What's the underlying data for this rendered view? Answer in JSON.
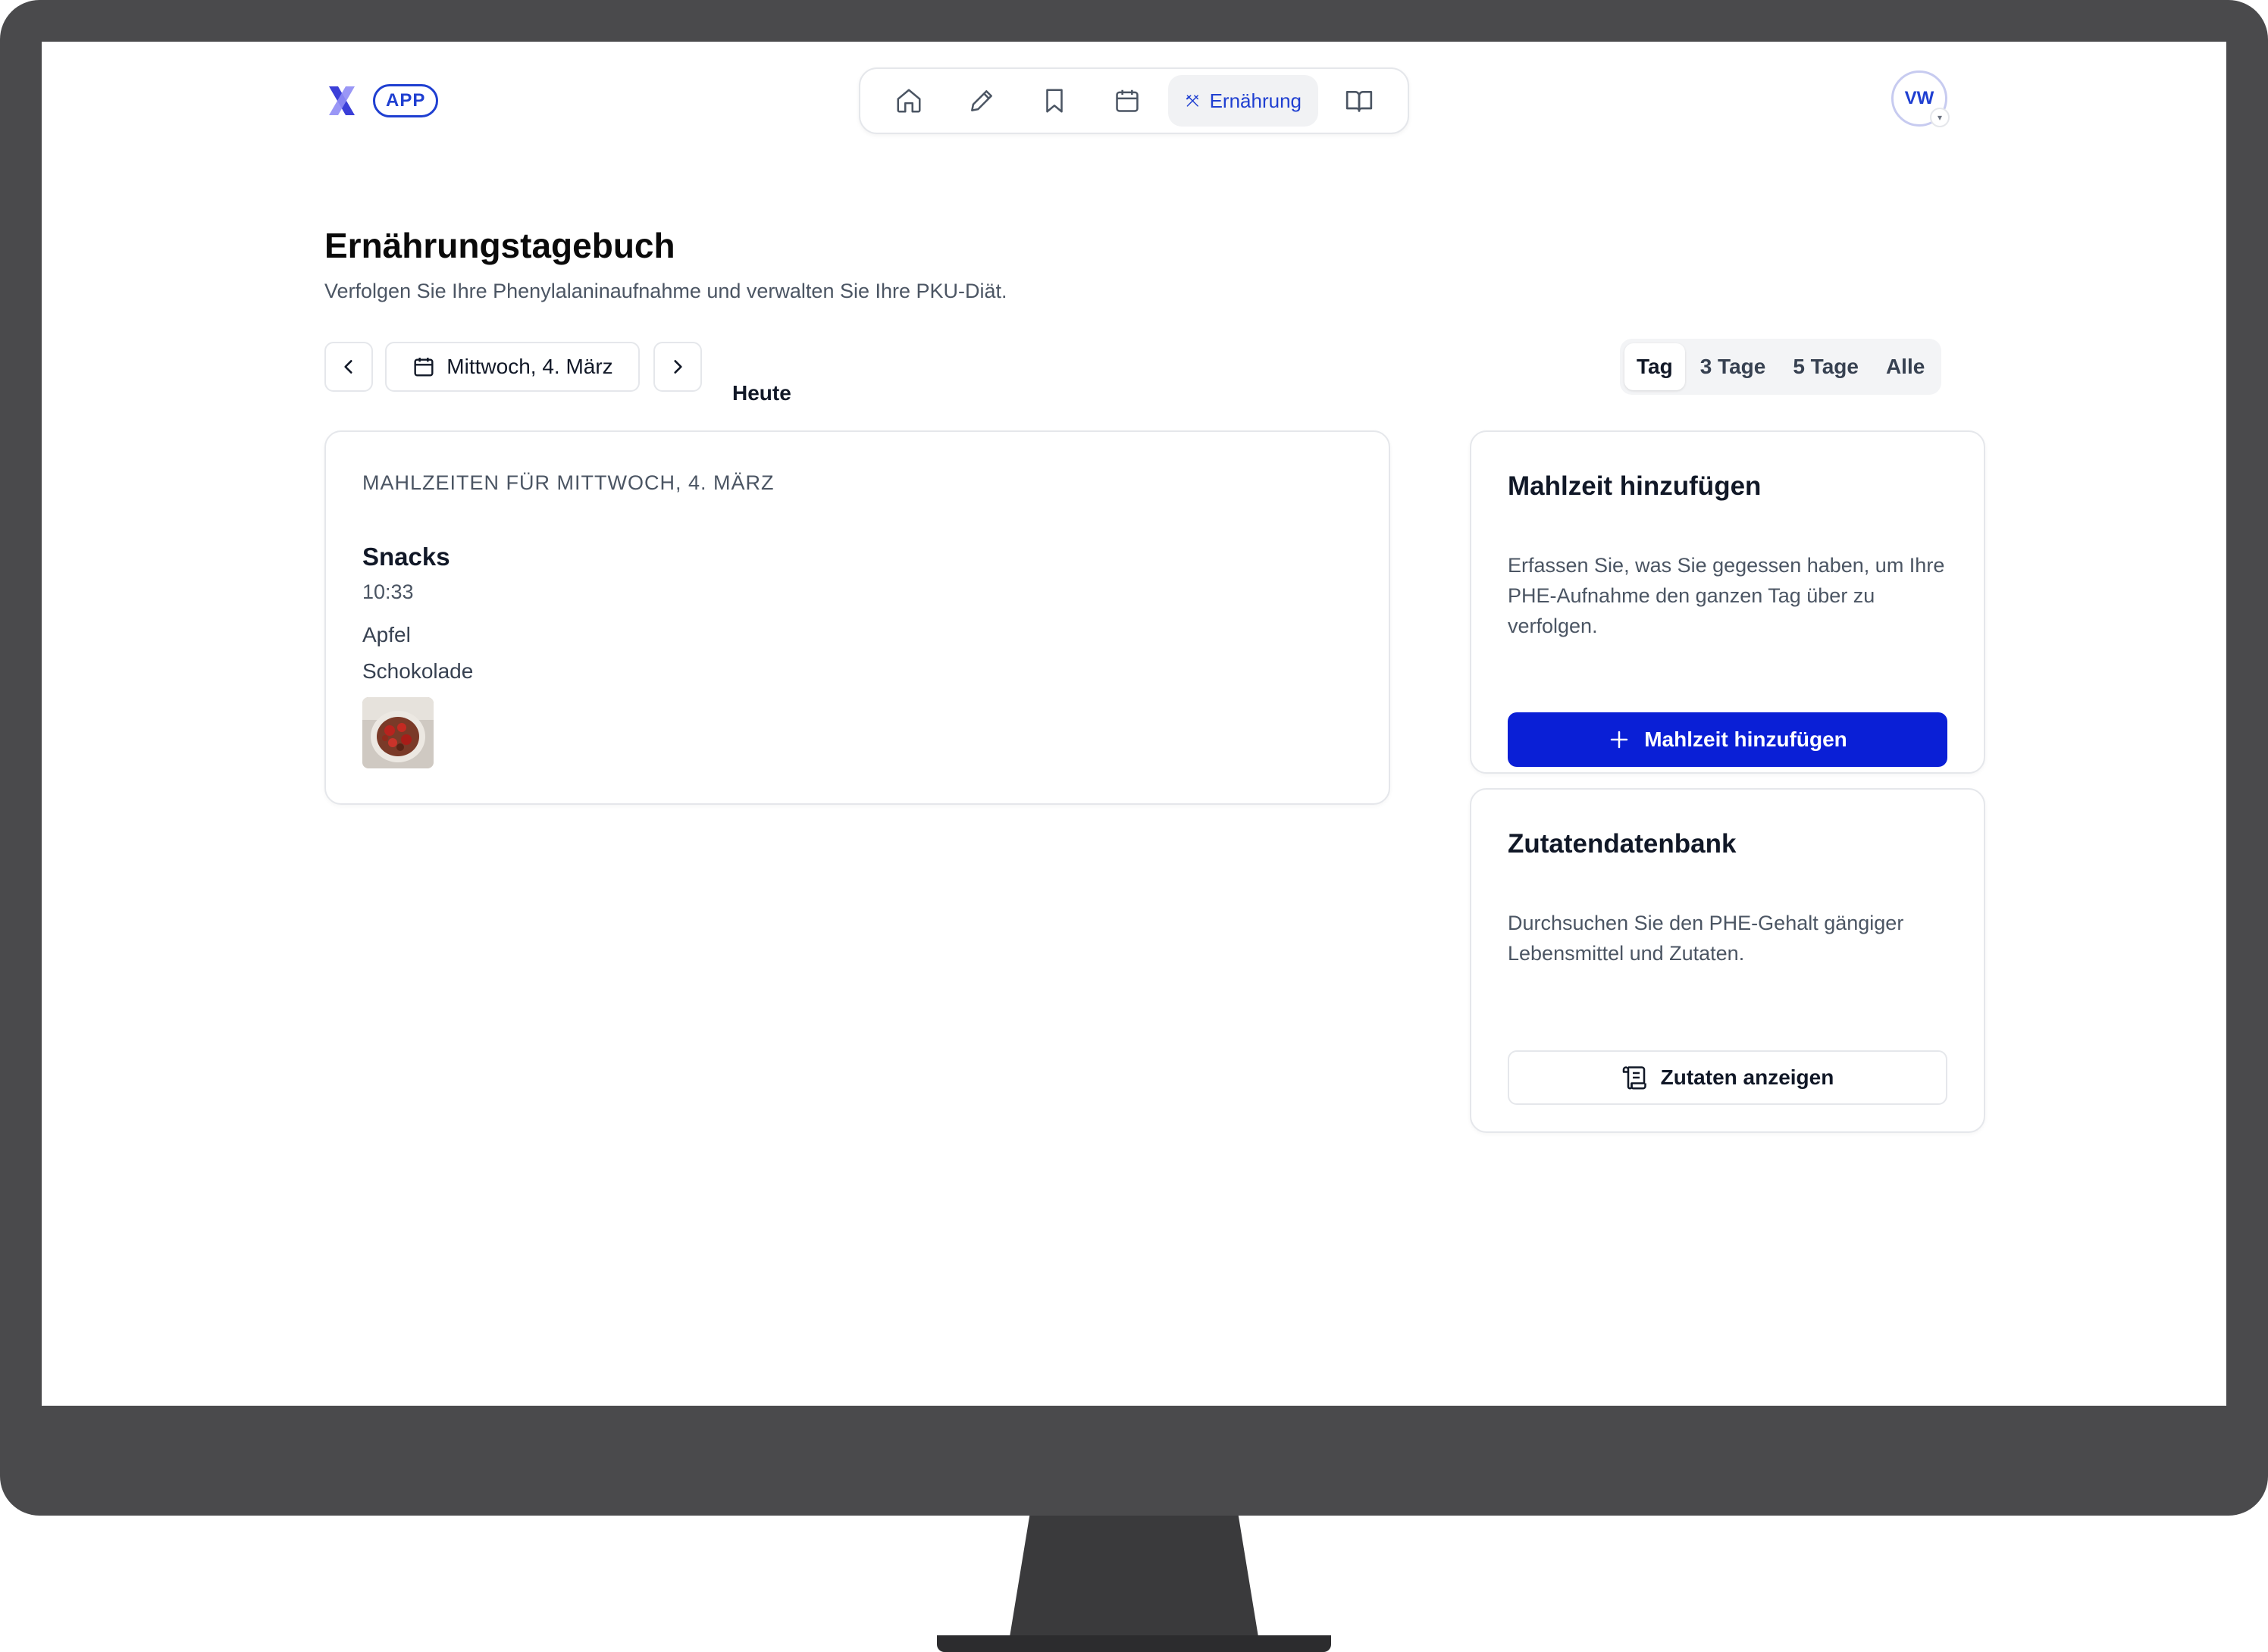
{
  "header": {
    "app_badge": "APP",
    "nav": [
      {
        "icon": "home-icon"
      },
      {
        "icon": "pencil-icon"
      },
      {
        "icon": "bookmark-icon"
      },
      {
        "icon": "calendar-icon"
      },
      {
        "icon": "utensils-icon",
        "label": "Ernährung",
        "active": true
      },
      {
        "icon": "book-open-icon"
      }
    ],
    "avatar_initials": "VW"
  },
  "page": {
    "title": "Ernährungstagebuch",
    "subtitle": "Verfolgen Sie Ihre Phenylalaninaufnahme und verwalten Sie Ihre PKU-Diät."
  },
  "date_nav": {
    "current_date": "Mittwoch, 4. März",
    "today_label": "Heute"
  },
  "range": {
    "options": [
      "Tag",
      "3 Tage",
      "5 Tage",
      "Alle"
    ],
    "selected": "Tag"
  },
  "meals": {
    "heading": "MAHLZEITEN FÜR MITTWOCH, 4. MÄRZ",
    "items": [
      {
        "name": "Snacks",
        "time": "10:33",
        "foods": [
          "Apfel",
          "Schokolade"
        ]
      }
    ]
  },
  "add_meal": {
    "title": "Mahlzeit hinzufügen",
    "description": "Erfassen Sie, was Sie gegessen haben, um Ihre PHE-Aufnahme den ganzen Tag über zu verfolgen.",
    "button_label": "Mahlzeit hinzufügen"
  },
  "ingredient_db": {
    "title": "Zutatendatenbank",
    "description": "Durchsuchen Sie den PHE-Gehalt gängiger Lebensmittel und Zutaten.",
    "button_label": "Zutaten anzeigen"
  },
  "colors": {
    "accent": "#0a1fd6",
    "brand_blue": "#1f3fd1",
    "logo_violet": "#6d6af0",
    "bezel": "#4a4a4c"
  }
}
